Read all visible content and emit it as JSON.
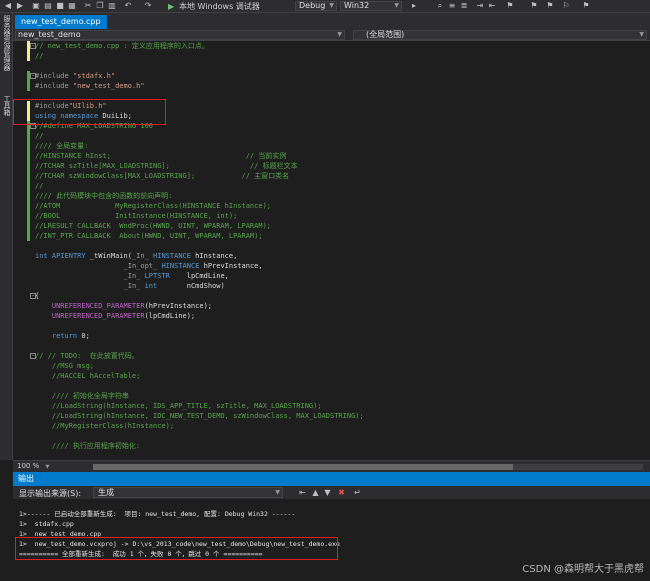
{
  "toolbar": {
    "run_target": "本地 Windows 调试器",
    "config": "Debug",
    "platform": "Win32"
  },
  "left_tabs": [
    "服务器资源管理器",
    "工具箱"
  ],
  "tab": {
    "title": "new_test_demo.cpp"
  },
  "navbar": {
    "file": "new_test_demo",
    "scope": "(全局范围)"
  },
  "code": [
    "// new_test_demo.cpp : 定义应用程序的入口点。",
    "//",
    "",
    "#include \"stdafx.h\"",
    "#include \"new_test_demo.h\"",
    "",
    "#include\"UIlib.h\"",
    "using namespace DuiLib;",
    "//#define MAX_LOADSTRING 100",
    "//",
    "//// 全局变量:",
    "//HINSTANCE hInst;                                // 当前实例",
    "//TCHAR szTitle[MAX_LOADSTRING];                   // 标题栏文本",
    "//TCHAR szWindowClass[MAX_LOADSTRING];           // 主窗口类名",
    "//",
    "//// 此代码模块中包含的函数的前向声明:",
    "//ATOM             MyRegisterClass(HINSTANCE hInstance);",
    "//BOOL             InitInstance(HINSTANCE, int);",
    "//LRESULT CALLBACK  WndProc(HWND, UINT, WPARAM, LPARAM);",
    "//INT_PTR CALLBACK  About(HWND, UINT, WPARAM, LPARAM);",
    "",
    "int APIENTRY _tWinMain(_In_ HINSTANCE hInstance,",
    "                     _In_opt_ HINSTANCE hPrevInstance,",
    "                     _In_ LPTSTR    lpCmdLine,",
    "                     _In_ int       nCmdShow)",
    "{",
    "    UNREFERENCED_PARAMETER(hPrevInstance);",
    "    UNREFERENCED_PARAMETER(lpCmdLine);",
    "",
    "    return 0;",
    "",
    "// // TODO:  在此放置代码。",
    "    //MSG msg;",
    "    //HACCEL hAccelTable;",
    "",
    "    //// 初始化全局字符串",
    "    //LoadString(hInstance, IDS_APP_TITLE, szTitle, MAX_LOADSTRING);",
    "    //LoadString(hInstance, IDC_NEW_TEST_DEMO, szWindowClass, MAX_LOADSTRING);",
    "    //MyRegisterClass(hInstance);",
    "",
    "    //// 执行应用程序初始化:"
  ],
  "zoom": "100 %",
  "output": {
    "title": "输出",
    "source_label": "显示输出来源(S):",
    "source_value": "生成",
    "lines": [
      "1>------ 已启动全部重新生成:  项目: new_test_demo, 配置: Debug Win32 ------",
      "1>  stdafx.cpp",
      "1>  new_test_demo.cpp",
      "1>  new_test_demo.vcxproj -> D:\\vs_2013_code\\new_test_demo\\Debug\\new_test_demo.exe",
      "========== 全部重新生成:  成功 1 个，失败 0 个，跳过 0 个 =========="
    ]
  },
  "watermark": "CSDN @森明帮大于黑虎帮"
}
